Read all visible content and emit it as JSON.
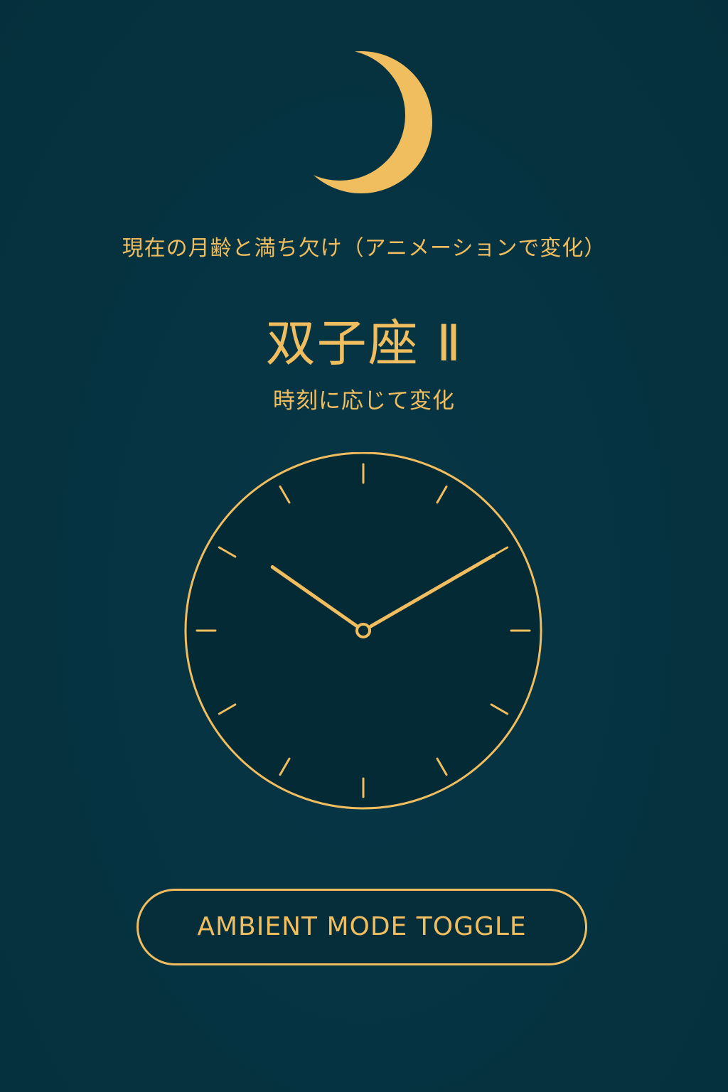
{
  "colors": {
    "background": "#063341",
    "accent": "#f0bd5f",
    "clock_face": "#042a35"
  },
  "moon": {
    "icon": "crescent-moon-icon",
    "caption": "現在の月齢と満ち欠け（アニメーションで変化）"
  },
  "zodiac": {
    "name": "双子座 Ⅱ",
    "caption": "時刻に応じて変化"
  },
  "clock": {
    "hour": 10,
    "minute": 10,
    "tick_count": 12
  },
  "toggle": {
    "label": "AMBIENT MODE TOGGLE"
  }
}
